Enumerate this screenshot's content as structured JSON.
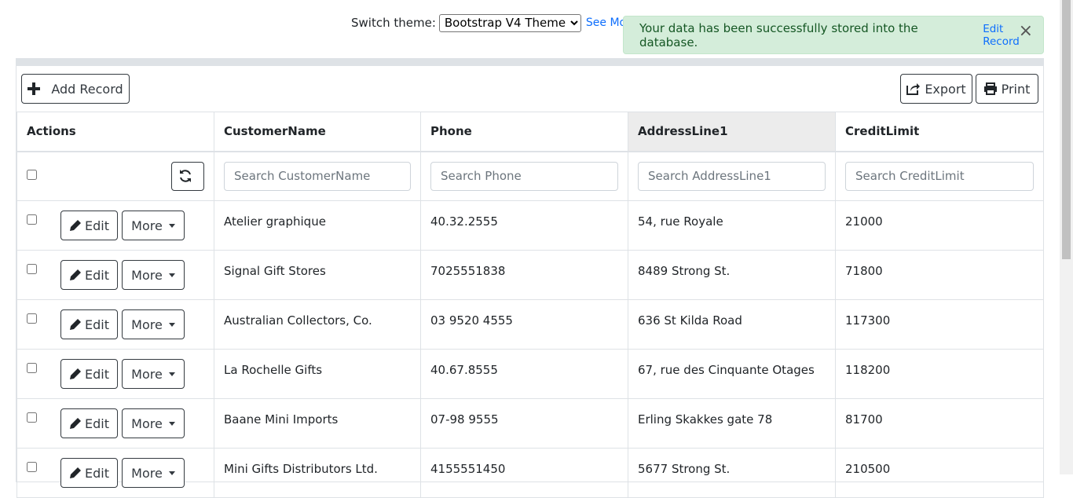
{
  "topbar": {
    "switch_label": "Switch theme:",
    "theme_selected": "Bootstrap V4 Theme",
    "see_more": "See More a"
  },
  "alert": {
    "message": "Your data has been successfully stored into the database.",
    "edit_link": "Edit Record",
    "close_symbol": "×"
  },
  "toolbar": {
    "add_label": "Add Record",
    "export_label": "Export",
    "print_label": "Print"
  },
  "table": {
    "headers": {
      "actions": "Actions",
      "customer_name": "CustomerName",
      "phone": "Phone",
      "address": "AddressLine1",
      "credit": "CreditLimit"
    },
    "placeholders": {
      "customer_name": "Search CustomerName",
      "phone": "Search Phone",
      "address": "Search AddressLine1",
      "credit": "Search CreditLimit"
    },
    "edit_label": "Edit",
    "more_label": "More",
    "rows": [
      {
        "name": "Atelier graphique",
        "phone": "40.32.2555",
        "address": "54, rue Royale",
        "credit": "21000"
      },
      {
        "name": "Signal Gift Stores",
        "phone": "7025551838",
        "address": "8489 Strong St.",
        "credit": "71800"
      },
      {
        "name": "Australian Collectors, Co.",
        "phone": "03 9520 4555",
        "address": "636 St Kilda Road",
        "credit": "117300"
      },
      {
        "name": "La Rochelle Gifts",
        "phone": "40.67.8555",
        "address": "67, rue des Cinquante Otages",
        "credit": "118200"
      },
      {
        "name": "Baane Mini Imports",
        "phone": "07-98 9555",
        "address": "Erling Skakkes gate 78",
        "credit": "81700"
      },
      {
        "name": "Mini Gifts Distributors Ltd.",
        "phone": "4155551450",
        "address": "5677 Strong St.",
        "credit": "210500"
      }
    ]
  }
}
